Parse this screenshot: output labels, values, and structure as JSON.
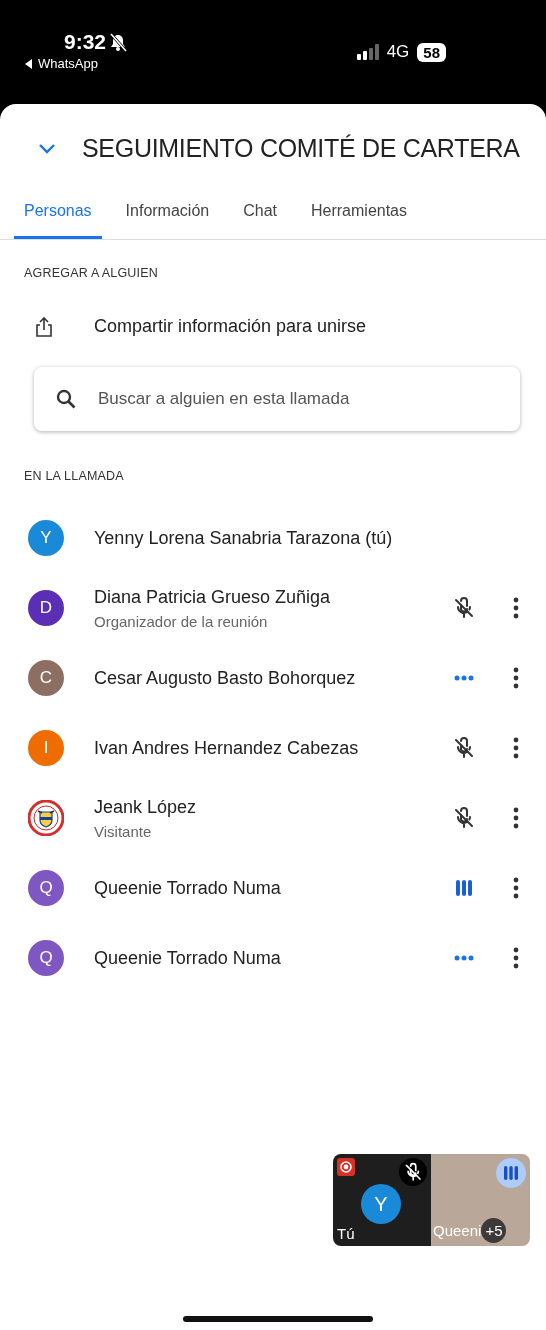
{
  "status_bar": {
    "time": "9:32",
    "back_app": "WhatsApp",
    "network": "4G",
    "battery": "58"
  },
  "header": {
    "title": "SEGUIMIENTO COMITÉ DE CARTERA"
  },
  "tabs": [
    {
      "label": "Personas",
      "selected": true
    },
    {
      "label": "Información",
      "selected": false
    },
    {
      "label": "Chat",
      "selected": false
    },
    {
      "label": "Herramientas",
      "selected": false
    }
  ],
  "add_section": {
    "heading": "AGREGAR A ALGUIEN",
    "share_label": "Compartir información para unirse",
    "search": {
      "placeholder": "Buscar a alguien en esta llamada"
    }
  },
  "call_section": {
    "heading": "EN LA LLAMADA",
    "participants": [
      {
        "avatar": {
          "kind": "letter",
          "initial": "Y",
          "color": "#1a8ad8"
        },
        "name": "Yenny Lorena Sanabria Tarazona (tú)",
        "menu": false
      },
      {
        "avatar": {
          "kind": "letter",
          "initial": "D",
          "color": "#5b2fb5"
        },
        "name": "Diana Patricia Grueso Zuñiga",
        "role": "Organizador de la reunión",
        "audio": {
          "kind": "muted"
        },
        "menu": true
      },
      {
        "avatar": {
          "kind": "letter",
          "initial": "C",
          "color": "#8d6e63"
        },
        "name": "Cesar Augusto Basto Bohorquez",
        "audio": {
          "kind": "waiting"
        },
        "menu": true
      },
      {
        "avatar": {
          "kind": "letter",
          "initial": "I",
          "color": "#ef6c00"
        },
        "name": "Ivan Andres Hernandez Cabezas",
        "audio": {
          "kind": "muted"
        },
        "menu": true
      },
      {
        "avatar": {
          "kind": "emblem"
        },
        "name": "Jeank López",
        "role": "Visitante",
        "audio": {
          "kind": "muted"
        },
        "menu": true
      },
      {
        "avatar": {
          "kind": "letter",
          "initial": "Q",
          "color": "#7e57c2"
        },
        "name": "Queenie Torrado Numa",
        "audio": {
          "kind": "speaking"
        },
        "menu": true
      },
      {
        "avatar": {
          "kind": "letter",
          "initial": "Q",
          "color": "#7e57c2"
        },
        "name": "Queenie Torrado Numa",
        "audio": {
          "kind": "waiting"
        },
        "menu": true
      }
    ]
  },
  "self_view": {
    "self_tile": {
      "initial": "Y",
      "label": "Tú",
      "recording": true,
      "muted": true
    },
    "other_tile": {
      "label": "Queeni",
      "extra_count": "+5",
      "speaking": true
    }
  }
}
